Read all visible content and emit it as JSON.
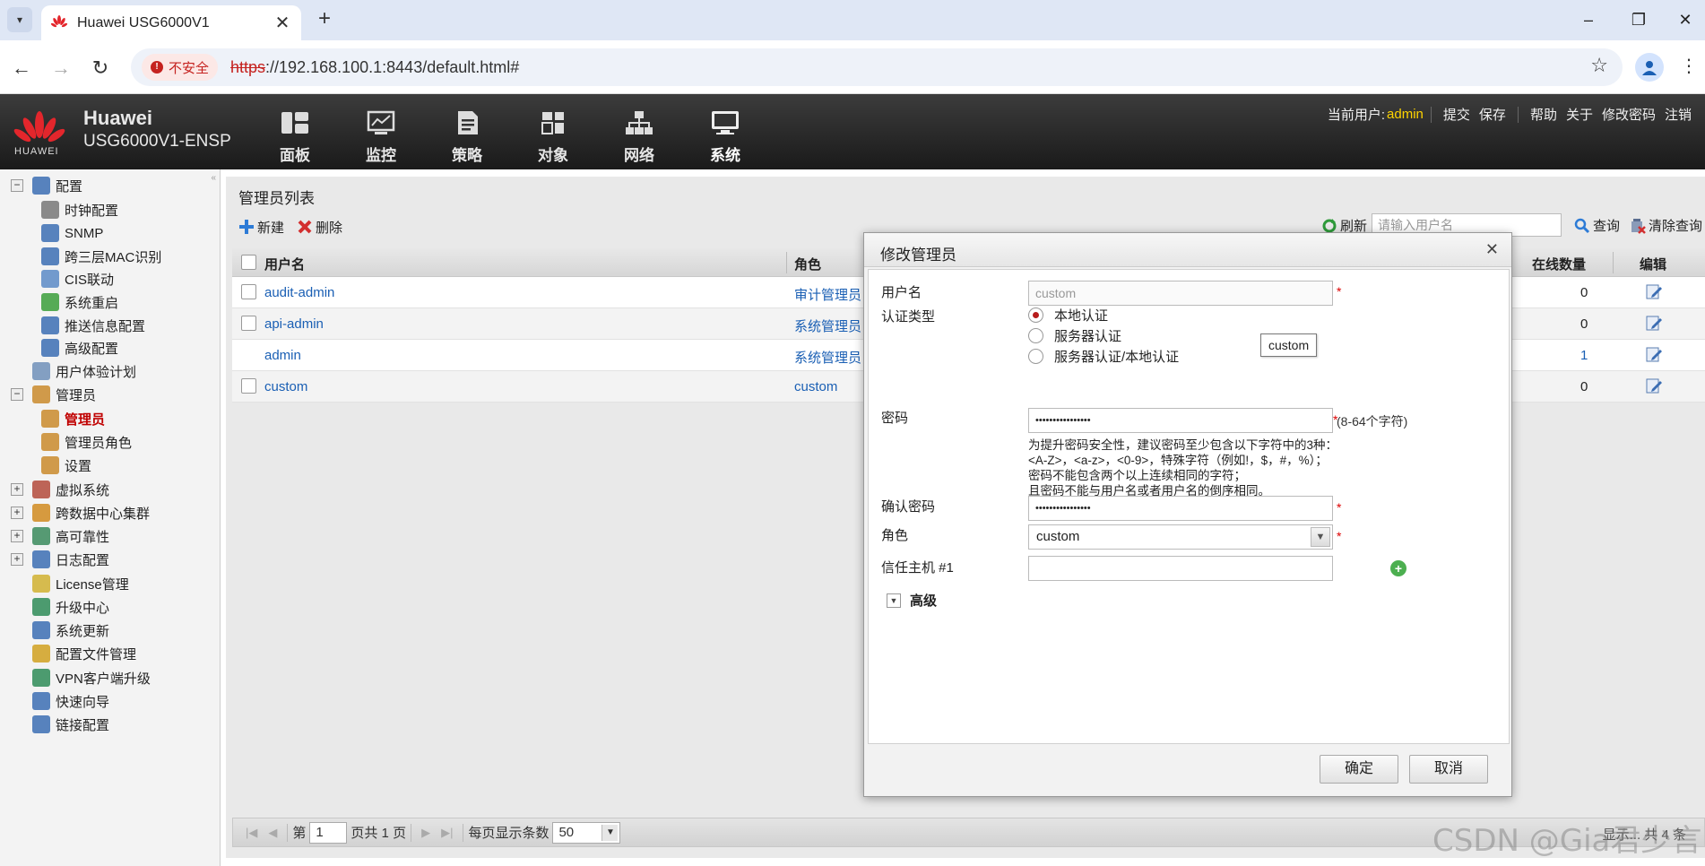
{
  "browser": {
    "tab_title": "Huawei USG6000V1",
    "security_label": "不安全",
    "url_scheme": "https",
    "url_rest": "://192.168.100.1:8443/default.html#"
  },
  "header": {
    "logo_text": "HUAWEI",
    "product_name": "Huawei",
    "product_model": "USG6000V1-ENSP",
    "nav": [
      {
        "label": "面板",
        "icon": "dashboard-icon"
      },
      {
        "label": "监控",
        "icon": "monitor-icon"
      },
      {
        "label": "策略",
        "icon": "policy-icon"
      },
      {
        "label": "对象",
        "icon": "object-icon"
      },
      {
        "label": "网络",
        "icon": "network-icon"
      },
      {
        "label": "系统",
        "icon": "system-icon"
      }
    ],
    "current_user_label": "当前用户:",
    "current_user": "admin",
    "links": [
      "提交",
      "保存",
      "帮助",
      "关于",
      "修改密码",
      "注销"
    ]
  },
  "sidebar": {
    "items": [
      {
        "label": "配置",
        "level": 0,
        "expander": "−"
      },
      {
        "label": "时钟配置",
        "level": 1
      },
      {
        "label": "SNMP",
        "level": 1
      },
      {
        "label": "跨三层MAC识别",
        "level": 1
      },
      {
        "label": "CIS联动",
        "level": 1
      },
      {
        "label": "系统重启",
        "level": 1
      },
      {
        "label": "推送信息配置",
        "level": 1
      },
      {
        "label": "高级配置",
        "level": 1
      },
      {
        "label": "用户体验计划",
        "level": 0
      },
      {
        "label": "管理员",
        "level": 0,
        "expander": "−"
      },
      {
        "label": "管理员",
        "level": 1,
        "selected": true
      },
      {
        "label": "管理员角色",
        "level": 1
      },
      {
        "label": "设置",
        "level": 1
      },
      {
        "label": "虚拟系统",
        "level": 0,
        "expander": "+"
      },
      {
        "label": "跨数据中心集群",
        "level": 0,
        "expander": "+"
      },
      {
        "label": "高可靠性",
        "level": 0,
        "expander": "+"
      },
      {
        "label": "日志配置",
        "level": 0,
        "expander": "+"
      },
      {
        "label": "License管理",
        "level": 0
      },
      {
        "label": "升级中心",
        "level": 0
      },
      {
        "label": "系统更新",
        "level": 0
      },
      {
        "label": "配置文件管理",
        "level": 0
      },
      {
        "label": "VPN客户端升级",
        "level": 0
      },
      {
        "label": "快速向导",
        "level": 0
      },
      {
        "label": "链接配置",
        "level": 0
      }
    ]
  },
  "main": {
    "title": "管理员列表",
    "toolbar": {
      "new_label": "新建",
      "delete_label": "删除",
      "refresh_label": "刷新",
      "search_placeholder": "请输入用户名",
      "query_label": "查询",
      "clear_query_label": "清除查询"
    },
    "columns": {
      "username": "用户名",
      "role": "角色",
      "online": "在线数量",
      "edit": "编辑"
    },
    "rows": [
      {
        "username": "audit-admin",
        "role": "审计管理员",
        "online": "0",
        "checkbox": true
      },
      {
        "username": "api-admin",
        "role": "系统管理员",
        "online": "0",
        "checkbox": true
      },
      {
        "username": "admin",
        "role": "系统管理员",
        "online": "1",
        "checkbox": false
      },
      {
        "username": "custom",
        "role": "custom",
        "online": "0",
        "checkbox": true
      }
    ],
    "pager": {
      "page_prefix": "第",
      "page_value": "1",
      "page_suffix": "页共 1 页",
      "page_size_label": "每页显示条数",
      "page_size": "50",
      "summary": "显示... 共 4 条"
    }
  },
  "dialog": {
    "title": "修改管理员",
    "username_label": "用户名",
    "username_placeholder": "custom",
    "tooltip": "custom",
    "auth_type_label": "认证类型",
    "auth_options": [
      "本地认证",
      "服务器认证",
      "服务器认证/本地认证"
    ],
    "auth_selected": "本地认证",
    "password_label": "密码",
    "password_value": "••••••••••••••••",
    "password_range": "(8-64个字符)",
    "password_hint": [
      "为提升密码安全性，建议密码至少包含以下字符中的3种：",
      "<A-Z>，<a-z>，<0-9>，特殊字符（例如!，$，#，%）；",
      "密码不能包含两个以上连续相同的字符；",
      "且密码不能与用户名或者用户名的倒序相同。"
    ],
    "confirm_password_label": "确认密码",
    "confirm_password_value": "••••••••••••••••",
    "role_label": "角色",
    "role_value": "custom",
    "trusted_host_label": "信任主机 #1",
    "advanced_label": "高级",
    "ok_label": "确定",
    "cancel_label": "取消",
    "required_mark": "*"
  },
  "watermark": "CSDN @Gia君少言",
  "colors": {
    "header_bg": "#2b2b2b",
    "link": "#1a5fb4",
    "selected_tree": "#c00000",
    "user_highlight": "#ffd400",
    "radio_on": "#b71c1c"
  }
}
